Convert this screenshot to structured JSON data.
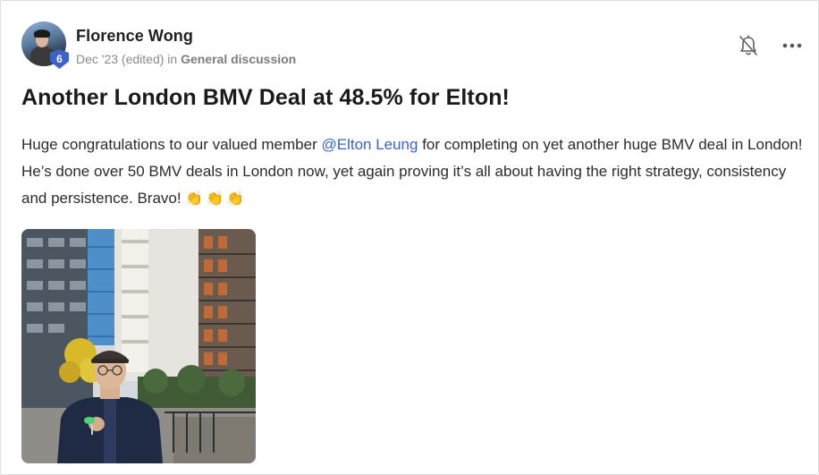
{
  "post": {
    "author": "Florence Wong",
    "level": "6",
    "date": "Dec '23 (edited)",
    "in_label": "in",
    "space": "General discussion",
    "title": "Another London BMV Deal at 48.5% for Elton!",
    "body_pre": "Huge congratulations to our valued member ",
    "mention": "@Elton Leung",
    "body_post": " for completing on yet another huge BMV deal in London! He’s done over 50 BMV deals in London now, yet again proving it’s all about having the right strategy, consistency and persistence. Bravo! ",
    "reactions": "👏👏👏"
  },
  "icons": {
    "bell": "bell-off-icon",
    "more": "more-horizontal-icon"
  },
  "colors": {
    "mention": "#3b62c8",
    "level_badge": "#3d63c9"
  }
}
